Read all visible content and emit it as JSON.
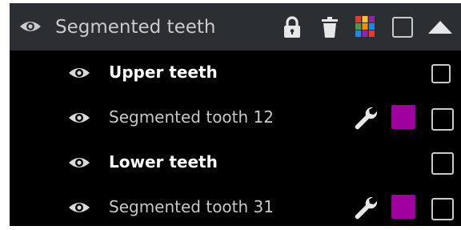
{
  "group": {
    "title": "Segmented teeth",
    "icons": [
      "eye-icon",
      "lock-icon",
      "trash-icon",
      "color-palette-icon",
      "checkbox",
      "collapse-arrow-icon"
    ]
  },
  "items": [
    {
      "label": "Upper teeth",
      "style": "bold",
      "swatch_color": null
    },
    {
      "label": "Segmented tooth 12",
      "style": "normal",
      "tool_icon": "wrench-icon",
      "swatch_color": "#a000a0"
    },
    {
      "label": "Lower teeth",
      "style": "bold",
      "swatch_color": null
    },
    {
      "label": "Segmented tooth 31",
      "style": "normal",
      "tool_icon": "wrench-icon",
      "swatch_color": "#a000a0"
    }
  ],
  "colors": {
    "header_bg": "#2b2e32",
    "panel_bg": "#000000",
    "accent_purple": "#a000a0"
  }
}
